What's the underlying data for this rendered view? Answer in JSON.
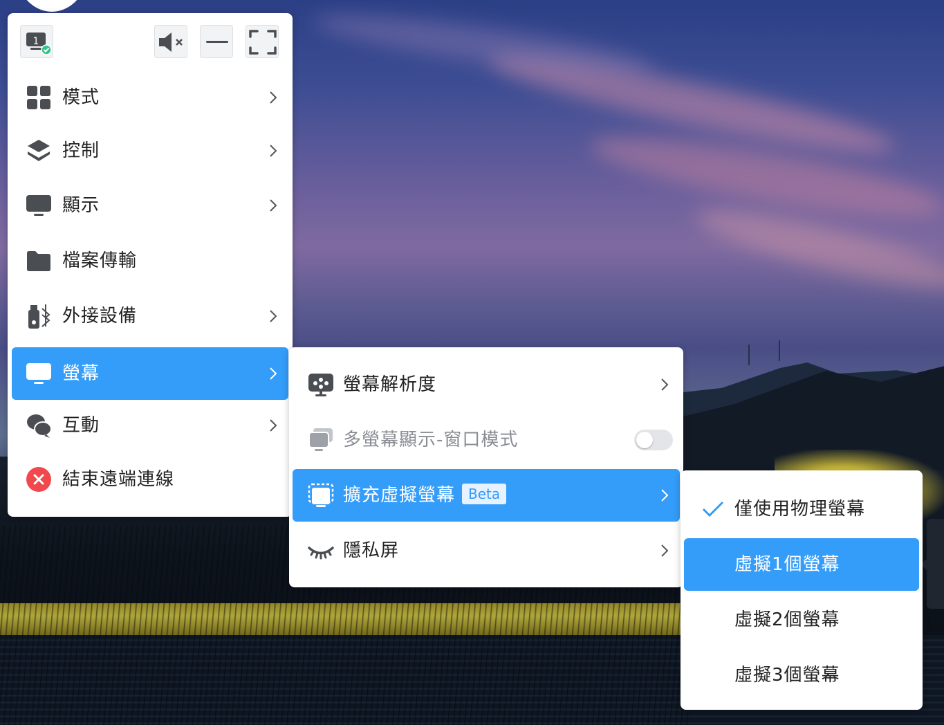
{
  "colors": {
    "accent": "#349cf9",
    "text": "#222222",
    "disabled_text": "#8a8d93",
    "menu_bg": "#ffffff",
    "icon_gray": "#4a4d52",
    "danger": "#f0484d",
    "success": "#31c48d"
  },
  "toolbar": {
    "display_badge": "1",
    "icons": [
      "display-1-icon",
      "mute-icon",
      "minimize-icon",
      "fullscreen-icon"
    ]
  },
  "main_menu": {
    "items": [
      {
        "label": "模式",
        "icon": "grid-icon",
        "has_submenu": true
      },
      {
        "label": "控制",
        "icon": "layers-icon",
        "has_submenu": true
      },
      {
        "label": "顯示",
        "icon": "monitor-icon",
        "has_submenu": true
      },
      {
        "label": "檔案傳輸",
        "icon": "folder-icon",
        "has_submenu": false
      },
      {
        "label": "外接設備",
        "icon": "usb-bluetooth-icon",
        "has_submenu": true
      },
      {
        "label": "螢幕",
        "icon": "screen-icon",
        "has_submenu": true,
        "active": true
      },
      {
        "label": "互動",
        "icon": "chat-icon",
        "has_submenu": true
      },
      {
        "label": "結束遠端連線",
        "icon": "close-circle-icon",
        "has_submenu": false
      }
    ]
  },
  "screen_submenu": {
    "items": [
      {
        "label": "螢幕解析度",
        "icon": "resolution-icon",
        "has_submenu": true
      },
      {
        "label": "多螢幕顯示-窗口模式",
        "icon": "multi-screen-icon",
        "disabled": true,
        "toggle_on": false
      },
      {
        "label": "擴充虛擬螢幕",
        "badge": "Beta",
        "icon": "virtual-screen-icon",
        "has_submenu": true,
        "active": true
      },
      {
        "label": "隱私屏",
        "icon": "closed-eye-icon",
        "has_submenu": true
      }
    ]
  },
  "virtual_screen_submenu": {
    "items": [
      {
        "label": "僅使用物理螢幕",
        "checked": true
      },
      {
        "label": "虛擬1個螢幕",
        "active": true
      },
      {
        "label": "虛擬2個螢幕"
      },
      {
        "label": "虛擬3個螢幕"
      }
    ]
  }
}
